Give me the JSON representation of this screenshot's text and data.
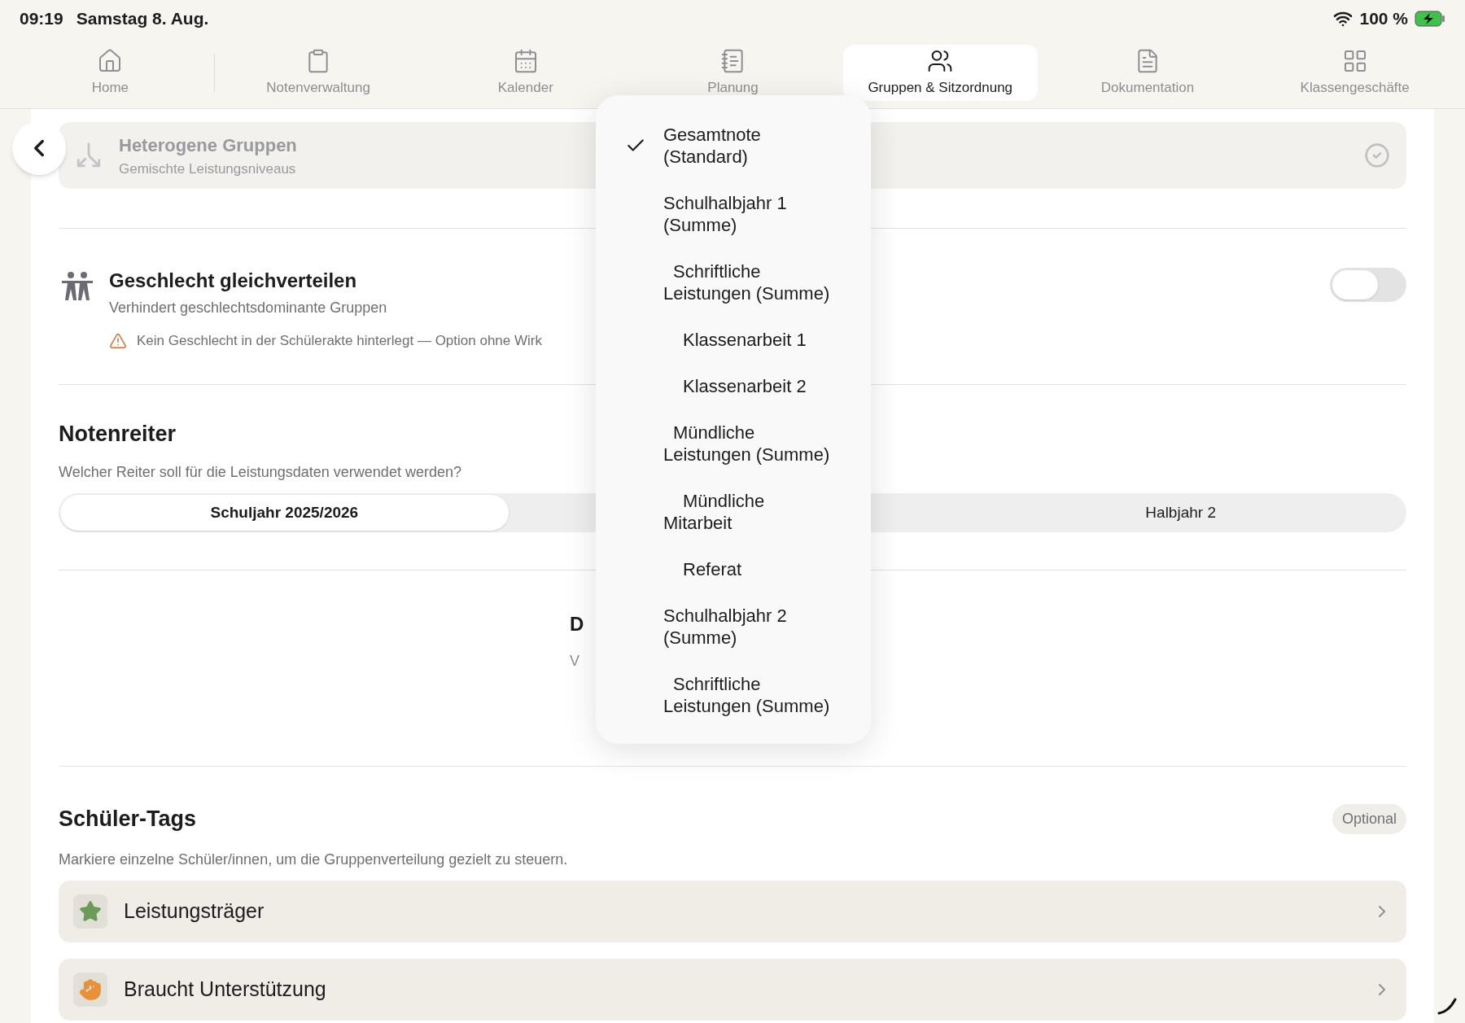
{
  "status_bar": {
    "time": "09:19",
    "date": "Samstag 8. Aug.",
    "battery": "100 %"
  },
  "tabs": [
    {
      "label": "Home",
      "selected": false
    },
    {
      "label": "Notenverwaltung",
      "selected": false
    },
    {
      "label": "Kalender",
      "selected": false
    },
    {
      "label": "Planung",
      "selected": false
    },
    {
      "label": "Gruppen & Sitzordnung",
      "selected": true
    },
    {
      "label": "Dokumentation",
      "selected": false
    },
    {
      "label": "Klassengeschäfte",
      "selected": false
    }
  ],
  "header": {
    "title": "Heterogene Gruppen",
    "subtitle": "Gemischte Leistungsniveaus"
  },
  "gender_option": {
    "title": "Geschlecht gleichverteilen",
    "subtitle": "Verhindert geschlechtsdominante Gruppen",
    "warning": "Kein Geschlecht in der Schülerakte hinterlegt — Option ohne Wirk",
    "on": false
  },
  "grade_tab": {
    "heading": "Notenreiter",
    "description": "Welcher Reiter soll für die Leistungsdaten verwendet werden?",
    "segments": [
      {
        "label": "Schuljahr 2025/2026",
        "selected": true
      },
      {
        "label": "Halbjahr 2",
        "selected": false
      }
    ]
  },
  "covered_section": {
    "heading": "D",
    "description": "V"
  },
  "tags": {
    "heading": "Schüler-Tags",
    "badge": "Optional",
    "description": "Markiere einzelne Schüler/innen, um die Gruppenverteilung gezielt zu steuern.",
    "items": [
      {
        "label": "Leistungsträger",
        "kind": "star",
        "color": "#6b9a5b"
      },
      {
        "label": "Braucht Unterstützung",
        "kind": "hand",
        "color": "#e8913a"
      }
    ]
  },
  "dropdown": {
    "items": [
      {
        "label": "Gesamtnote (Standard)",
        "selected": true
      },
      {
        "label": "Schulhalbjahr 1 (Summe)",
        "selected": false,
        "children": [
          {
            "label": "Schriftliche Leistungen (Summe)",
            "selected": false,
            "children": [
              {
                "label": "Klassenarbeit 1",
                "selected": false
              },
              {
                "label": "Klassenarbeit 2",
                "selected": false
              }
            ]
          },
          {
            "label": "Mündliche Leistungen (Summe)",
            "selected": false,
            "children": [
              {
                "label": "Mündliche Mitarbeit",
                "selected": false
              },
              {
                "label": "Referat",
                "selected": false
              }
            ]
          }
        ]
      },
      {
        "label": "Schulhalbjahr 2 (Summe)",
        "selected": false,
        "children": [
          {
            "label": "Schriftliche Leistungen (Summe)",
            "selected": false
          }
        ]
      }
    ]
  }
}
